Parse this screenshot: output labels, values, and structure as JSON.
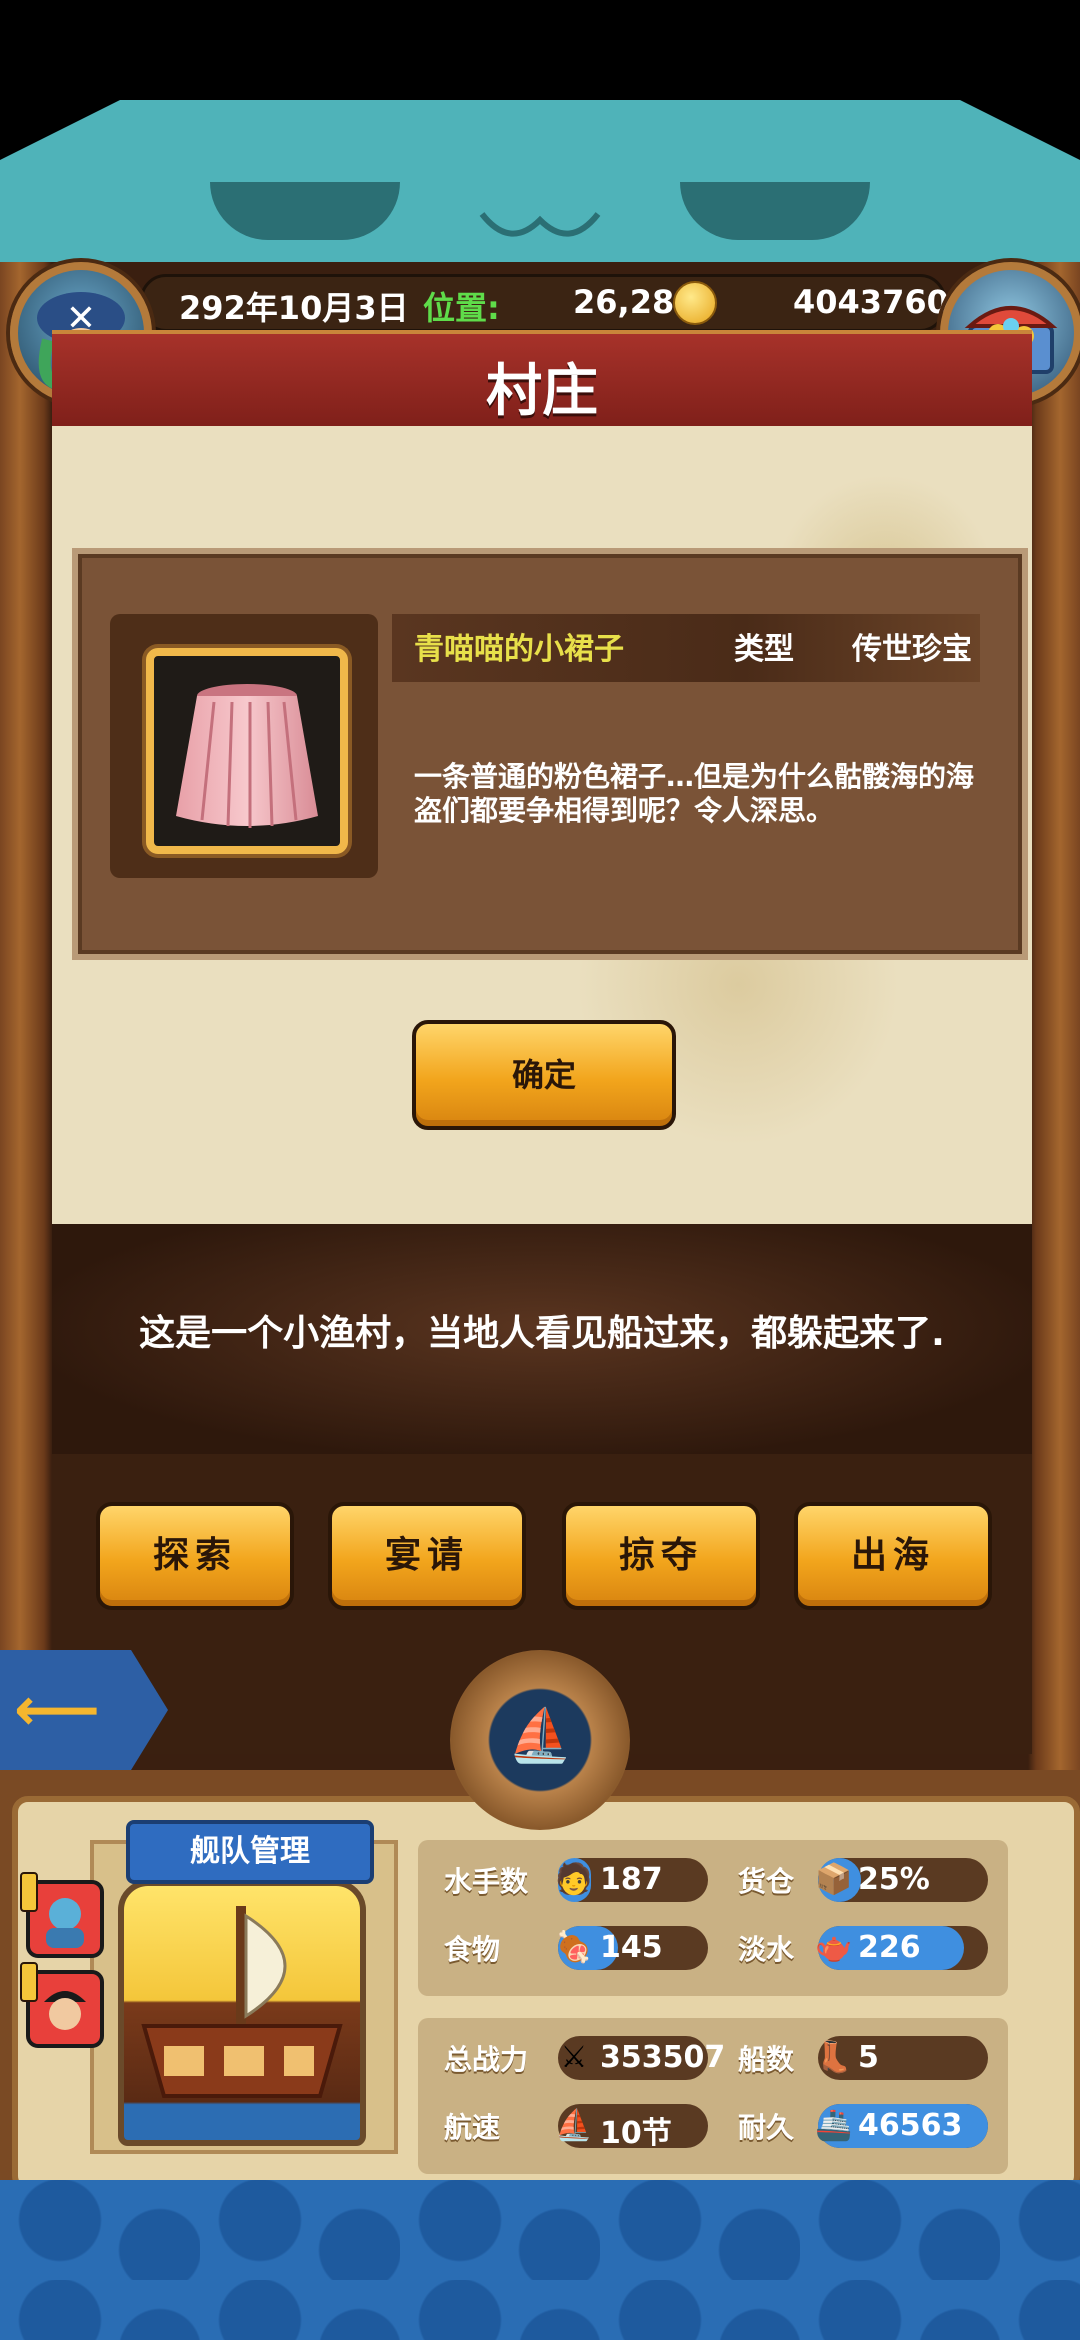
{
  "header": {
    "date": "292年10月3日",
    "location_label": "位置:",
    "location_value": "26,28",
    "gold": "4043760"
  },
  "page_title": "村庄",
  "item": {
    "name": "青喵喵的小裙子",
    "type_label": "类型",
    "type_value": "传世珍宝",
    "description": "一条普通的粉色裙子…但是为什么骷髅海的海盗们都要争相得到呢？令人深思。"
  },
  "confirm_label": "确定",
  "narrative": "这是一个小渔村，当地人看见船过来，都躲起来了.",
  "actions": [
    "探索",
    "宴请",
    "掠夺",
    "出海"
  ],
  "fleet": {
    "title": "舰队管理",
    "stats": {
      "sailors": {
        "label": "水手数",
        "value": "187",
        "level": 0.22
      },
      "cargo": {
        "label": "货仓",
        "value": "25%",
        "level": 0.25
      },
      "food": {
        "label": "食物",
        "value": "145",
        "level": 0.4
      },
      "water": {
        "label": "淡水",
        "value": "226",
        "level": 0.86
      },
      "power": {
        "label": "总战力",
        "value": "353507"
      },
      "ships": {
        "label": "船数",
        "value": "5"
      },
      "speed": {
        "label": "航速",
        "value": "10节"
      },
      "durability": {
        "label": "耐久",
        "value": "46563",
        "level": 1.0
      }
    }
  },
  "colors": {
    "accent_gold": "#f2a51c",
    "title_red": "#a7322a",
    "bar_blue": "#3f8fe0",
    "name_yellow": "#e8e04a"
  }
}
